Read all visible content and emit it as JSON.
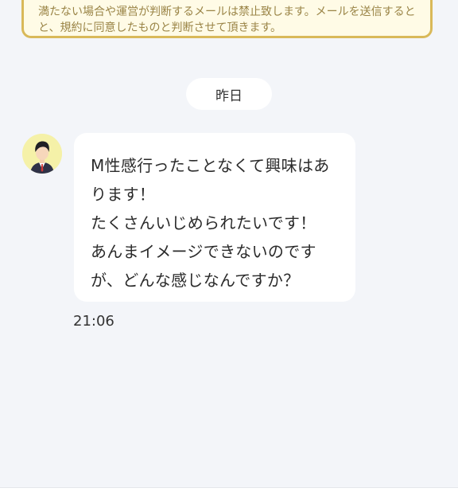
{
  "notice": {
    "line1": "満たない場合や運営が判断するメールは禁止致します。メールを送信すると",
    "line2": "と、規約に同意したものと判断させて頂きます。"
  },
  "date_divider": "昨日",
  "message": {
    "lines": [
      "M性感行ったことなくて興味はあ",
      "ります！",
      "たくさんいじめられたいです！",
      "あんまイメージできないのです",
      "が、どんな感じなんですか？"
    ],
    "time": "21:06"
  },
  "colors": {
    "background": "#f3f5f9",
    "notice_border": "#d9b959",
    "notice_fill": "#fffbe6",
    "bubble": "#ffffff",
    "avatar_bg": "#f5f1a8"
  },
  "icons": {
    "avatar": "person-icon"
  }
}
